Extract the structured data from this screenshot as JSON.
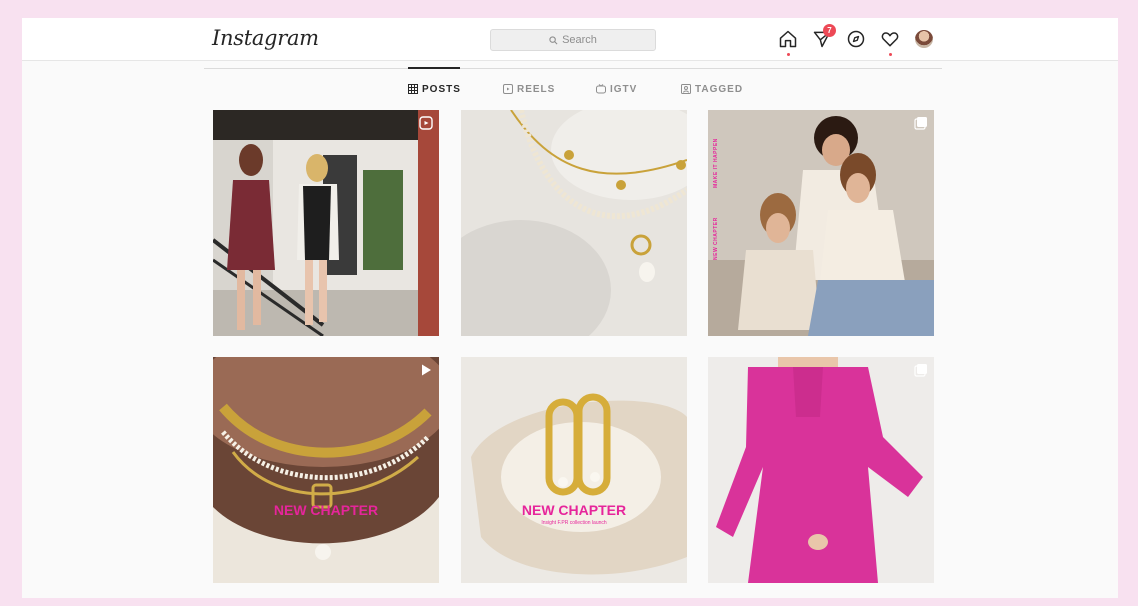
{
  "app": {
    "logo": "Instagram"
  },
  "search": {
    "placeholder": "Search"
  },
  "nav": {
    "items": [
      {
        "icon": "home-icon"
      },
      {
        "icon": "direct-messages-icon",
        "badge": "7"
      },
      {
        "icon": "explore-compass-icon"
      },
      {
        "icon": "activity-heart-icon"
      },
      {
        "icon": "profile-avatar"
      }
    ]
  },
  "tabs": [
    {
      "label": "POSTS",
      "icon": "grid-icon",
      "active": true
    },
    {
      "label": "REELS",
      "icon": "reels-icon",
      "active": false
    },
    {
      "label": "IGTV",
      "icon": "igtv-icon",
      "active": false
    },
    {
      "label": "TAGGED",
      "icon": "tagged-icon",
      "active": false
    }
  ],
  "posts": [
    {
      "type": "reel",
      "indicator": "reel-icon",
      "alt_overlay": ""
    },
    {
      "type": "photo",
      "indicator": "",
      "alt_overlay": ""
    },
    {
      "type": "carousel",
      "indicator": "carousel-icon",
      "side_texts": [
        "MAKE IT HAPPEN",
        "NEW CHAPTER"
      ]
    },
    {
      "type": "video",
      "indicator": "play-icon",
      "overlay_title": "NEW CHAPTER"
    },
    {
      "type": "photo",
      "indicator": "",
      "overlay_title": "NEW CHAPTER",
      "overlay_sub": "Insight F.PR collection launch"
    },
    {
      "type": "carousel",
      "indicator": "carousel-icon"
    }
  ],
  "colors": {
    "accent": "#e6259b",
    "badge": "#ed4956",
    "bg": "#f8e1f0"
  }
}
